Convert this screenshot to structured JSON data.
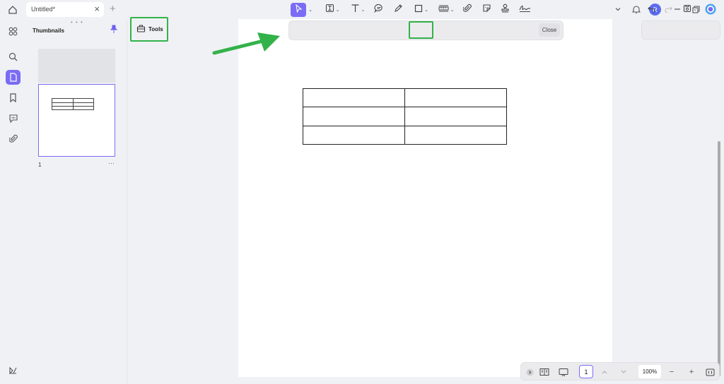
{
  "tab": {
    "title": "Untitled*",
    "close": "×",
    "new": "+"
  },
  "user": {
    "initial": "R"
  },
  "thumbnails": {
    "title": "Thumbnails",
    "grip": "• • •",
    "page_number": "1",
    "more": "···"
  },
  "tools": {
    "label": "Tools"
  },
  "toolbar": {
    "close_label": "Close"
  },
  "bottom": {
    "page_value": "1",
    "zoom": "100%",
    "minus": "−",
    "plus": "+"
  },
  "colors": {
    "accent": "#7a6cf5",
    "highlight": "#33b24a"
  }
}
